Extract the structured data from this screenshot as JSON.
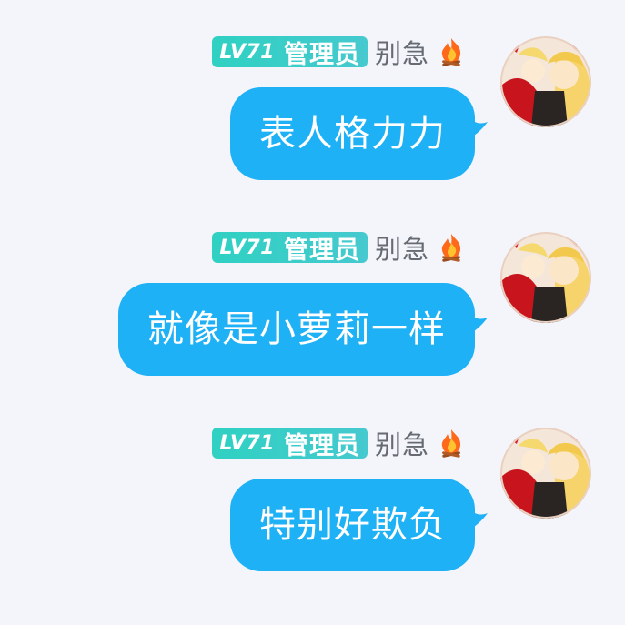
{
  "messages": [
    {
      "level": "LV71",
      "role": "管理员",
      "username": "别急",
      "badge_icon": "fire-icon",
      "text": "表人格力力"
    },
    {
      "level": "LV71",
      "role": "管理员",
      "username": "别急",
      "badge_icon": "fire-icon",
      "text": "就像是小萝莉一样"
    },
    {
      "level": "LV71",
      "role": "管理员",
      "username": "别急",
      "badge_icon": "fire-icon",
      "text": "特别好欺负"
    }
  ],
  "colors": {
    "background": "#f4f5fa",
    "bubble": "#1fb1f5",
    "level_badge": "#2fd1c2",
    "username": "#666a73"
  }
}
